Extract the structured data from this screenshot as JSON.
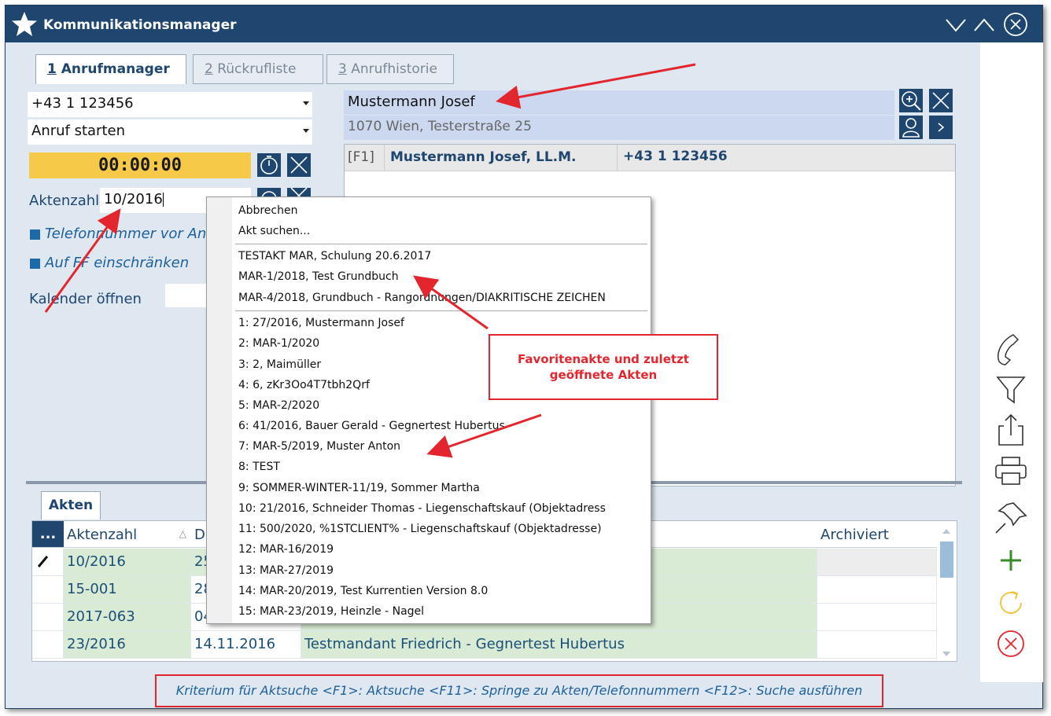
{
  "window": {
    "title": "Kommunikationsmanager"
  },
  "tabs": [
    {
      "num": "1",
      "label": "Anrufmanager"
    },
    {
      "num": "2",
      "label": "Rückrufliste"
    },
    {
      "num": "3",
      "label": "Anrufhistorie"
    }
  ],
  "call": {
    "phone_value": "+43 1 123456",
    "action_value": "Anruf starten",
    "timer": "00:00:00",
    "aktenzahl_label": "Aktenzahl:",
    "aktenzahl_value": "10/2016",
    "option_phone": "Telefonnummer vor Anr",
    "option_ff": "Auf FF einschränken",
    "calendar_label": "Kalender öffnen"
  },
  "contact": {
    "name": "Mustermann Josef",
    "address": "1070 Wien, Testerstraße 25",
    "result_key": "[F1]",
    "result_name": "Mustermann Josef, LL.M.",
    "result_phone": "+43 1 123456"
  },
  "akten": {
    "tab_label": "Akten",
    "menu_button": "...",
    "headers": {
      "aktenzahl": "Aktenzahl",
      "datum": "Da",
      "archiviert": "Archiviert",
      "sort_indicator": "△"
    },
    "rows": [
      {
        "aktenzahl": "10/2016",
        "datum": "25",
        "desc": ""
      },
      {
        "aktenzahl": "15-001",
        "datum": "28",
        "desc": ""
      },
      {
        "aktenzahl": "2017-063",
        "datum": "04",
        "desc": ""
      },
      {
        "aktenzahl": "23/2016",
        "datum": "14.11.2016",
        "desc": "Testmandant Friedrich - Gegnertest Hubertus"
      }
    ]
  },
  "context_menu": {
    "top": [
      {
        "label": "Abbrechen"
      },
      {
        "label": "Akt suchen..."
      }
    ],
    "favorites": [
      {
        "label": "TESTAKT MAR, Schulung 20.6.2017"
      },
      {
        "label": "MAR-1/2018, Test Grundbuch"
      },
      {
        "label": "MAR-4/2018, Grundbuch - Rangordnungen/DIAKRITISCHE ZEICHEN"
      }
    ],
    "recent": [
      {
        "label": "1: 27/2016, Mustermann Josef"
      },
      {
        "label": "2: MAR-1/2020"
      },
      {
        "label": "3: 2, Maimüller"
      },
      {
        "label": "4: 6, zKr3Oo4T7tbh2Qrf"
      },
      {
        "label": "5: MAR-2/2020"
      },
      {
        "label": "6: 41/2016, Bauer Gerald - Gegnertest Hubertus"
      },
      {
        "label": "7: MAR-5/2019, Muster Anton"
      },
      {
        "label": "8: TEST"
      },
      {
        "label": "9: SOMMER-WINTER-11/19, Sommer Martha"
      },
      {
        "label": "10: 21/2016, Schneider Thomas - Liegenschaftskauf (Objektadress"
      },
      {
        "label": "11: 500/2020, %1STCLIENT% - Liegenschaftskauf (Objektadresse)"
      },
      {
        "label": "12: MAR-16/2019"
      },
      {
        "label": "13: MAR-27/2019"
      },
      {
        "label": "14: MAR-20/2019, Test Kurrentien Version 8.0"
      },
      {
        "label": "15: MAR-23/2019, Heinzle - Nagel"
      }
    ]
  },
  "annotation": {
    "callout_line1": "Favoritenakte und zuletzt",
    "callout_line2": "geöffnete Akten"
  },
  "statusbar": {
    "text": "Kriterium für Aktsuche <F1>: Aktsuche <F11>: Springe zu Akten/Telefonnummern <F12>: Suche ausführen"
  },
  "colors": {
    "titlebar": "#1e466f",
    "background": "#dfe8f1",
    "timer": "#f7c948",
    "annotation_red": "#e3262e",
    "row_green": "#d9ebd4"
  },
  "icons": [
    "star-icon",
    "chevron-down-icon",
    "chevron-up-icon",
    "close-circle-icon",
    "timer-icon",
    "clear-icon",
    "zoom-in-icon",
    "person-icon",
    "next-icon",
    "phone-icon",
    "filter-icon",
    "share-icon",
    "print-icon",
    "pin-icon",
    "plus-icon",
    "refresh-icon",
    "cancel-icon",
    "pencil-icon"
  ]
}
